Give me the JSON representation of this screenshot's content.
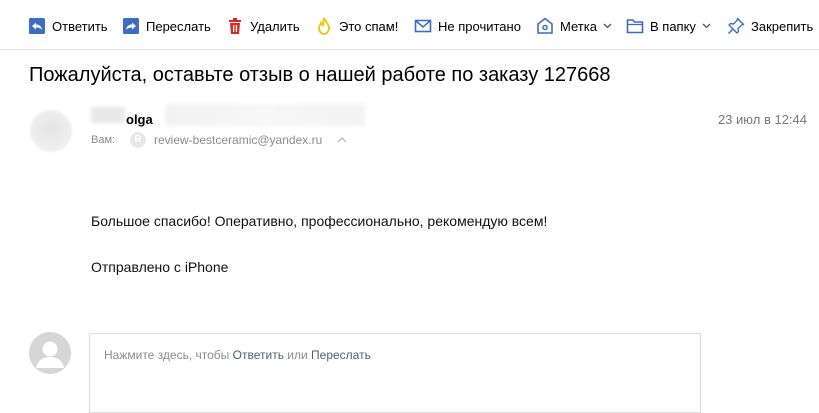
{
  "toolbar": {
    "reply": "Ответить",
    "forward": "Переслать",
    "delete": "Удалить",
    "spam": "Это спам!",
    "unread": "Не прочитано",
    "label": "Метка",
    "folder": "В папку",
    "pin": "Закрепить"
  },
  "message": {
    "subject": "Пожалуйста, оставьте отзыв о нашей работе по заказу 127668",
    "sender_name": "olga",
    "to_label": "Вам:",
    "to_badge": "R",
    "to_address": "review-bestceramic@yandex.ru",
    "date": "23 июл в 12:44",
    "body_line_1": "Большое спасибо! Оперативно, профессионально, рекомендую всем!",
    "body_line_2": "Отправлено с iPhone"
  },
  "reply": {
    "hint_prefix": "Нажмите здесь, чтобы ",
    "reply_link": "Ответить",
    "or": " или ",
    "forward_link": "Переслать"
  },
  "colors": {
    "icon_blue": "#3d6dbf",
    "delete_red": "#d9281f",
    "spam_yellow": "#f5c300",
    "link": "#4f5f7d"
  }
}
